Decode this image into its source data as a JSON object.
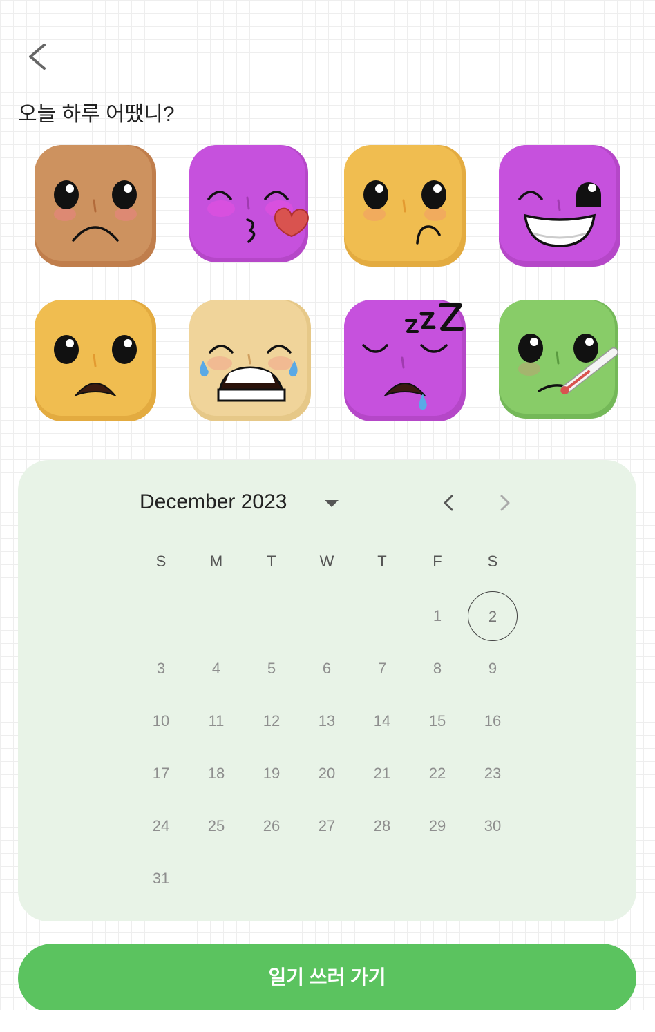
{
  "header": {
    "back_icon": "chevron-left-icon"
  },
  "title": "오늘 하루 어땠니?",
  "moods": [
    {
      "name": "sad",
      "color": "#c99060"
    },
    {
      "name": "kiss",
      "color": "#c651dd"
    },
    {
      "name": "confused",
      "color": "#f0bd50"
    },
    {
      "name": "wink",
      "color": "#c651dd"
    },
    {
      "name": "worried",
      "color": "#f0bd50"
    },
    {
      "name": "crying",
      "color": "#f0d49a"
    },
    {
      "name": "sleepy",
      "color": "#c651dd"
    },
    {
      "name": "sick",
      "color": "#88cc68"
    }
  ],
  "calendar": {
    "month_label": "December 2023",
    "weekdays": [
      "S",
      "M",
      "T",
      "W",
      "T",
      "F",
      "S"
    ],
    "days": [
      "1",
      "2",
      "3",
      "4",
      "5",
      "6",
      "7",
      "8",
      "9",
      "10",
      "11",
      "12",
      "13",
      "14",
      "15",
      "16",
      "17",
      "18",
      "19",
      "20",
      "21",
      "22",
      "23",
      "24",
      "25",
      "26",
      "27",
      "28",
      "29",
      "30",
      "31"
    ],
    "first_weekday_index": 5,
    "today": "2",
    "background": "#e8f3e7"
  },
  "cta": {
    "label": "일기 쓰러 가기",
    "color": "#5bc35f"
  }
}
